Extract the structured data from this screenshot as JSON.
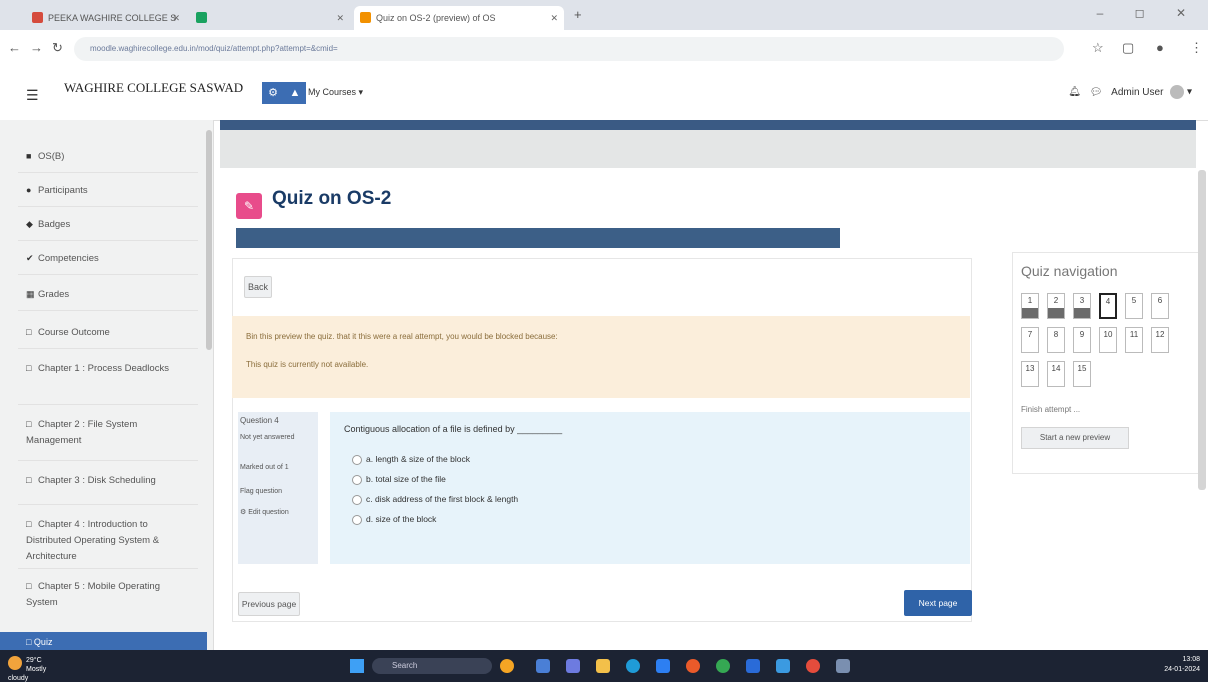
{
  "browser": {
    "tabs": [
      {
        "label": "PEEKA WAGHIRE COLLEGE S",
        "active": false,
        "color": "#d54b3d"
      },
      {
        "label": "",
        "active": false,
        "color": "#1aa260"
      },
      {
        "label": "Quiz on OS-2 (preview) of OS",
        "active": true,
        "color": "#f29100"
      }
    ],
    "url": "moodle.waghirecollege.edu.in/mod/quiz/attempt.php?attempt=&cmid=",
    "window_controls": "–  ◻  ✕"
  },
  "navbar": {
    "site_name": "WAGHIRE COLLEGE SASWAD",
    "my_courses": "My Courses ▾",
    "user": "Admin User",
    "user_dropdown": "▾"
  },
  "sidebar": {
    "items": [
      {
        "icon": "■",
        "label": "OS(B)"
      },
      {
        "icon": "●",
        "label": "Participants"
      },
      {
        "icon": "◆",
        "label": "Badges"
      },
      {
        "icon": "✔",
        "label": "Competencies"
      },
      {
        "icon": "▦",
        "label": "Grades"
      },
      {
        "icon": "□",
        "label": "Course Outcome"
      },
      {
        "icon": "□",
        "label": "Chapter 1 : Process Deadlocks"
      },
      {
        "icon": "□",
        "label": "Chapter 2 : File System Management"
      },
      {
        "icon": "□",
        "label": "Chapter 3 : Disk Scheduling"
      },
      {
        "icon": "□",
        "label": "Chapter 4 : Introduction to Distributed Operating System & Architecture"
      },
      {
        "icon": "□",
        "label": "Chapter 5 : Mobile Operating System"
      }
    ],
    "active_item": "□ Quiz"
  },
  "main": {
    "title": "Quiz on OS-2",
    "title_bar_text": "",
    "back_button": "Back",
    "warning_lines": [
      "Bin this preview the quiz. that it this were a real attempt, you would be blocked because:",
      "This quiz is currently not available."
    ],
    "question_info": {
      "label": "Question 4",
      "status": "Not yet answered",
      "marks": "Marked out of 1",
      "flag": "Flag question",
      "edit": "Edit question"
    },
    "question_text": "Contiguous allocation of a file is defined by _________",
    "options": [
      {
        "letter": "a.",
        "text": "length & size of the block"
      },
      {
        "letter": "b.",
        "text": "total size of the file"
      },
      {
        "letter": "c.",
        "text": "disk address of the first block & length"
      },
      {
        "letter": "d.",
        "text": "size of the block"
      }
    ],
    "previous_page": "Previous page",
    "next_page": "Next page"
  },
  "quiz_navigation": {
    "title": "Quiz navigation",
    "questions": [
      {
        "num": "1",
        "state": "answered"
      },
      {
        "num": "2",
        "state": "answered"
      },
      {
        "num": "3",
        "state": "answered"
      },
      {
        "num": "4",
        "state": "current"
      },
      {
        "num": "5",
        "state": "open"
      },
      {
        "num": "6",
        "state": "open"
      },
      {
        "num": "7",
        "state": "open"
      },
      {
        "num": "8",
        "state": "open"
      },
      {
        "num": "9",
        "state": "open"
      },
      {
        "num": "10",
        "state": "open"
      },
      {
        "num": "11",
        "state": "open"
      },
      {
        "num": "12",
        "state": "open"
      },
      {
        "num": "13",
        "state": "open"
      },
      {
        "num": "14",
        "state": "open"
      },
      {
        "num": "15",
        "state": "open"
      }
    ],
    "finish_attempt": "Finish attempt ...",
    "start_new_preview": "Start a new preview"
  },
  "taskbar": {
    "weather_temp": "29°C",
    "weather_desc": "Mostly cloudy",
    "search": "Search",
    "time": "13:08",
    "date": "24-01-2024"
  }
}
